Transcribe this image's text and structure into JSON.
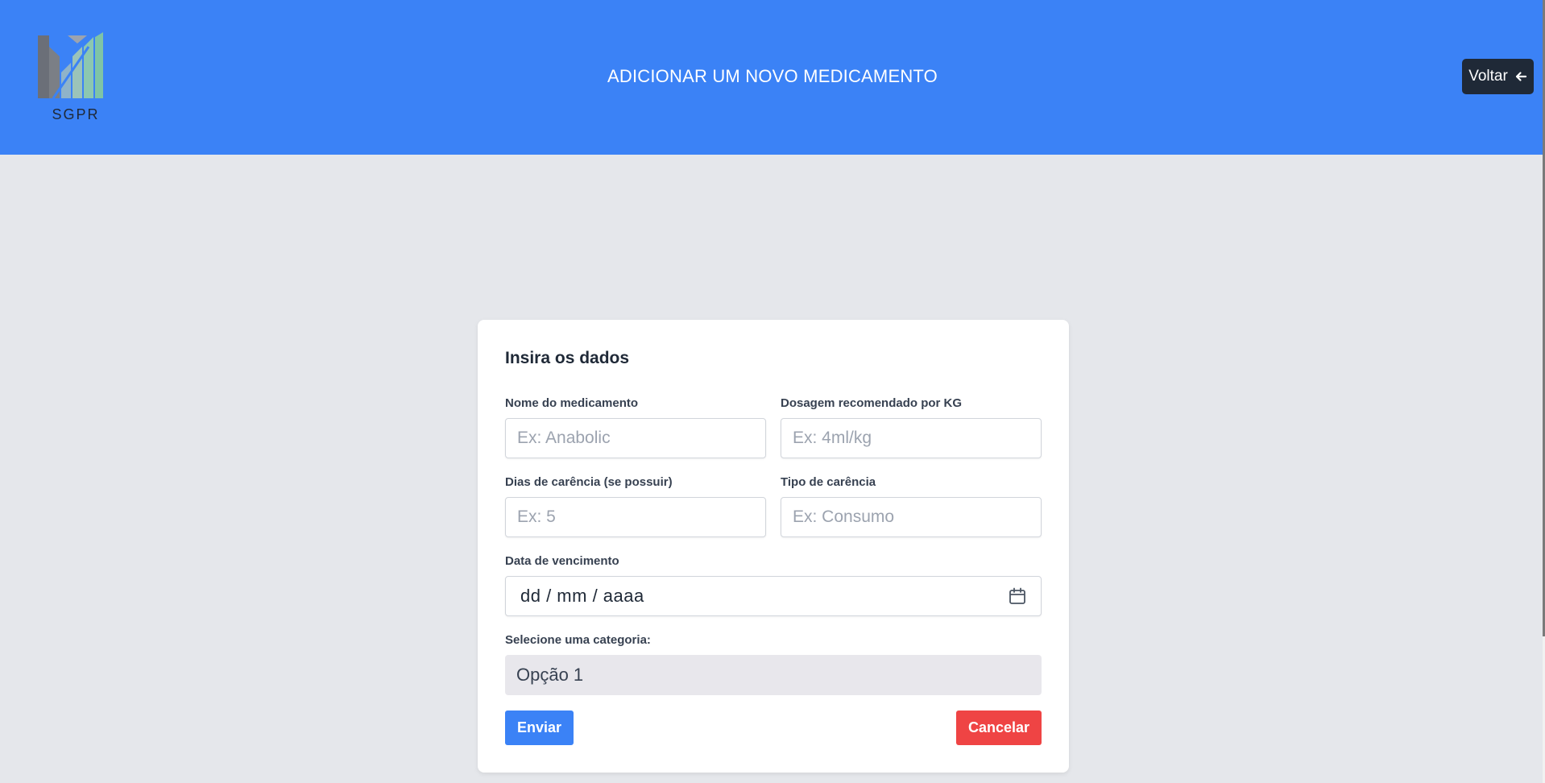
{
  "header": {
    "logo_text": "SGPR",
    "title": "ADICIONAR UM NOVO MEDICAMENTO",
    "back_button_label": "Voltar",
    "back_icon": "arrow-left-icon"
  },
  "colors": {
    "header_bg": "#3b82f6",
    "page_bg": "#e5e7eb",
    "back_button_bg": "#1f2937",
    "submit_bg": "#3b82f6",
    "cancel_bg": "#ef4444"
  },
  "form": {
    "title": "Insira os dados",
    "fields": {
      "name": {
        "label": "Nome do medicamento",
        "placeholder": "Ex: Anabolic",
        "value": ""
      },
      "dosage": {
        "label": "Dosagem recomendado por KG",
        "placeholder": "Ex: 4ml/kg",
        "value": ""
      },
      "grace_days": {
        "label": "Dias de carência (se possuir)",
        "placeholder": "Ex: 5",
        "value": ""
      },
      "grace_type": {
        "label": "Tipo de carência",
        "placeholder": "Ex: Consumo",
        "value": ""
      },
      "expiry_date": {
        "label": "Data de vencimento",
        "format": "dd / mm / aaaa",
        "icon": "calendar-icon"
      },
      "category": {
        "label": "Selecione uma categoria:",
        "selected": "Opção 1"
      }
    },
    "submit_label": "Enviar",
    "cancel_label": "Cancelar"
  }
}
